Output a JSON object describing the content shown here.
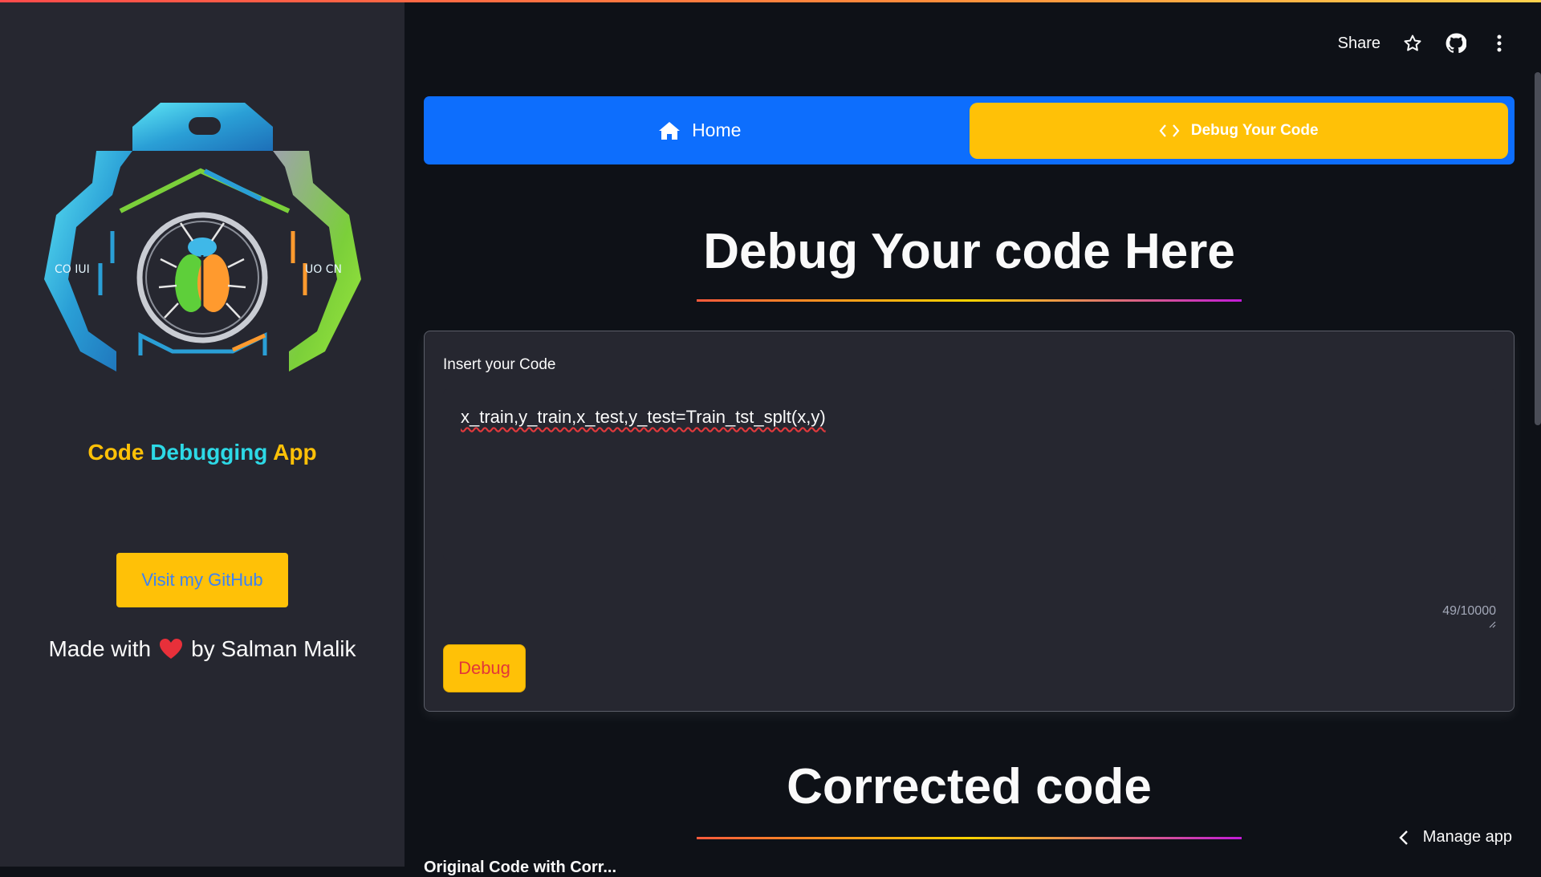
{
  "colors": {
    "background": "#0e1117",
    "sidebar_bg": "#262730",
    "nav_blue": "#0d6efd",
    "accent_yellow": "#ffc107",
    "title_cyan": "#2dd9e6"
  },
  "sidebar": {
    "logo_icon": "bug-circuit-logo",
    "app_title": {
      "part1": "Code",
      "part2": "Debugging",
      "part3": "App"
    },
    "github_button": "Visit my GitHub",
    "made_with": {
      "prefix": "Made with",
      "heart_icon": "heart-icon",
      "suffix": "by Salman Malik"
    }
  },
  "header": {
    "share": "Share",
    "icons": [
      "star-icon",
      "github-icon",
      "kebab-menu-icon"
    ]
  },
  "nav": {
    "items": [
      {
        "label": "Home",
        "icon": "home-icon",
        "active": false
      },
      {
        "label": "Debug Your Code",
        "icon": "code-icon",
        "active": true
      }
    ]
  },
  "main": {
    "title": "Debug Your code Here",
    "form": {
      "label": "Insert your Code",
      "code_value": "x_train,y_train,x_test,y_test=Train_tst_splt(x,y)",
      "char_counter": "49/10000",
      "debug_button": "Debug"
    },
    "corrected_title": "Corrected code",
    "partial_next_label": "Original Code with Corr..."
  },
  "footer": {
    "manage_app": "Manage app"
  }
}
